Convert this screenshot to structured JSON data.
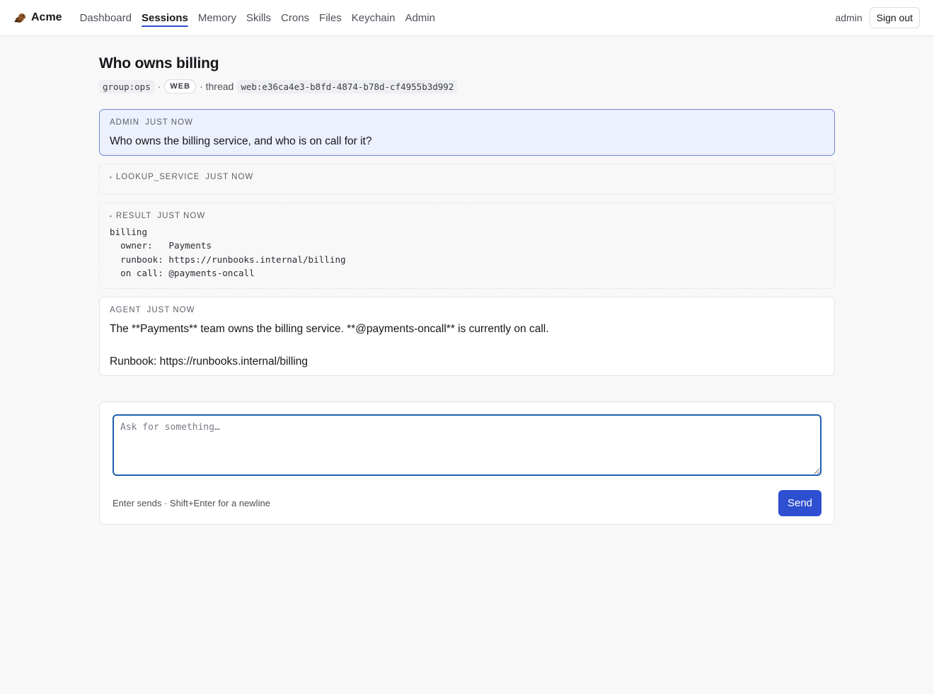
{
  "app": {
    "brand": "Acme",
    "brand_icon": "beaver-icon"
  },
  "nav": {
    "items": [
      {
        "label": "Dashboard"
      },
      {
        "label": "Sessions",
        "active": true
      },
      {
        "label": "Memory"
      },
      {
        "label": "Skills"
      },
      {
        "label": "Crons"
      },
      {
        "label": "Files"
      },
      {
        "label": "Keychain"
      },
      {
        "label": "Admin"
      }
    ],
    "user": "admin",
    "sign_out": "Sign out"
  },
  "session": {
    "title": "Who owns billing",
    "group": "group:ops",
    "separator": "·",
    "channel": "WEB",
    "thread_label": "· thread",
    "thread_id": "web:e36ca4e3-b8fd-4874-b78d-cf4955b3d992"
  },
  "messages": [
    {
      "role": "ADMIN",
      "time": "JUST NOW",
      "text": "Who owns the billing service, and who is on call for it?"
    },
    {
      "role": "LOOKUP_SERVICE",
      "time": "JUST NOW"
    },
    {
      "role": "RESULT",
      "time": "JUST NOW",
      "text": "billing\n  owner:   Payments\n  runbook: https://runbooks.internal/billing\n  on call: @payments-oncall"
    },
    {
      "role": "AGENT",
      "time": "JUST NOW",
      "line1": "The **Payments** team owns the billing service. **@payments-oncall** is currently on call.",
      "line2": "Runbook: https://runbooks.internal/billing"
    }
  ],
  "composer": {
    "placeholder": "Ask for something…",
    "value": "",
    "hint": "Enter sends · Shift+Enter for a newline",
    "send_label": "Send"
  },
  "colors": {
    "accent": "#2e4fd0",
    "user_bubble_bg": "#edf1fd",
    "user_bubble_border": "#6f86d8",
    "textarea_focus": "#1f5fae"
  }
}
